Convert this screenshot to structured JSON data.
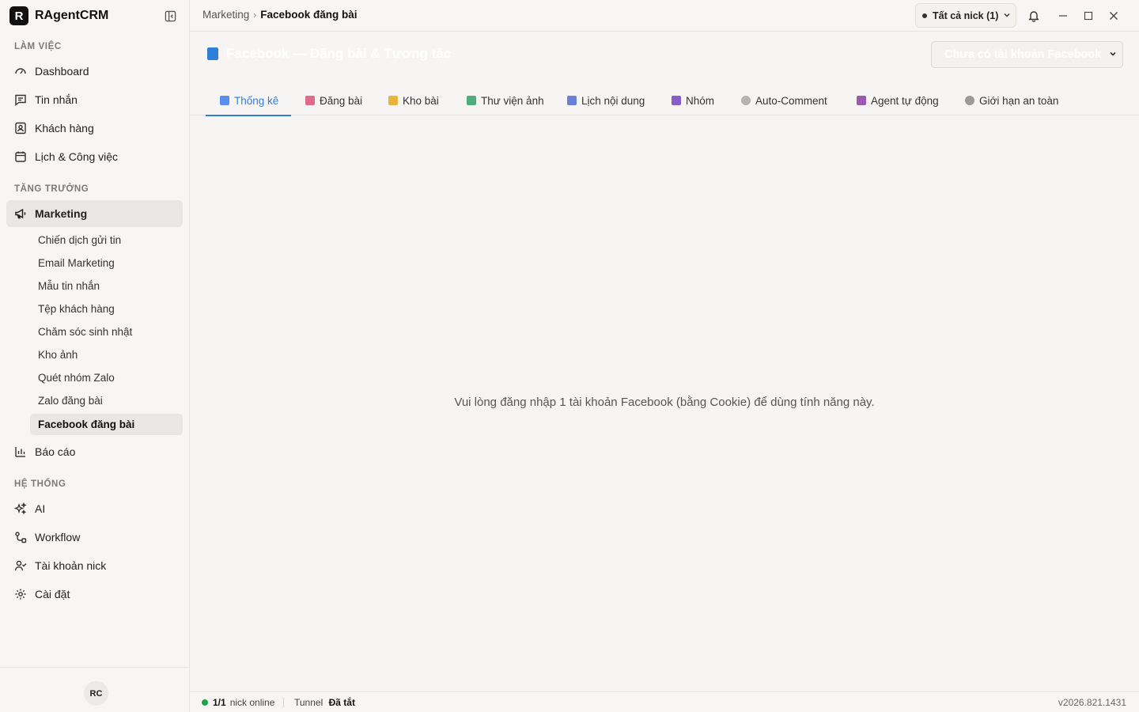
{
  "app": {
    "logo_letter": "R",
    "name": "RAgentCRM"
  },
  "sidebar": {
    "sections": {
      "work": "LÀM VIỆC",
      "growth": "TĂNG TRƯỞNG",
      "system": "HỆ THỐNG"
    },
    "work_items": [
      {
        "label": "Dashboard",
        "icon": "gauge-icon"
      },
      {
        "label": "Tin nhắn",
        "icon": "message-icon"
      },
      {
        "label": "Khách hàng",
        "icon": "contact-icon"
      },
      {
        "label": "Lịch & Công việc",
        "icon": "calendar-icon"
      }
    ],
    "marketing": {
      "label": "Marketing",
      "icon": "megaphone-icon"
    },
    "marketing_sub": [
      "Chiến dịch gửi tin",
      "Email Marketing",
      "Mẫu tin nhắn",
      "Tệp khách hàng",
      "Chăm sóc sinh nhật",
      "Kho ảnh",
      "Quét nhóm Zalo",
      "Zalo đăng bài",
      "Facebook đăng bài"
    ],
    "reports": {
      "label": "Báo cáo",
      "icon": "bar-chart-icon"
    },
    "system_items": [
      {
        "label": "AI",
        "icon": "sparkles-icon"
      },
      {
        "label": "Workflow",
        "icon": "workflow-icon"
      },
      {
        "label": "Tài khoản nick",
        "icon": "user-check-icon"
      },
      {
        "label": "Cài đặt",
        "icon": "gear-icon"
      }
    ],
    "avatar_initials": "RC"
  },
  "topbar": {
    "breadcrumb": [
      "Marketing",
      "Facebook đăng bài"
    ],
    "nick_selector": "Tất cả nick (1)"
  },
  "page": {
    "title": "Facebook — Đăng bài & Tương tác",
    "account_select": "Chưa có tài khoản Facebook"
  },
  "tabs": [
    {
      "label": "Thống kê",
      "active": true,
      "icon_color": "#5b8def"
    },
    {
      "label": "Đăng bài",
      "active": false,
      "icon_color": "#e06a8a"
    },
    {
      "label": "Kho bài",
      "active": false,
      "icon_color": "#e8b43c"
    },
    {
      "label": "Thư viện ảnh",
      "active": false,
      "icon_color": "#4caf7a"
    },
    {
      "label": "Lịch nội dung",
      "active": false,
      "icon_color": "#6a7fd8"
    },
    {
      "label": "Nhóm",
      "active": false,
      "icon_color": "#8a5cc8"
    },
    {
      "label": "Auto-Comment",
      "active": false,
      "icon_color": "#b7b3ae"
    },
    {
      "label": "Agent tự động",
      "active": false,
      "icon_color": "#9a5ab0"
    },
    {
      "label": "Giới hạn an toàn",
      "active": false,
      "icon_color": "#9a9a9a"
    }
  ],
  "content": {
    "message": "Vui lòng đăng nhập 1 tài khoản Facebook (bằng Cookie) để dùng tính năng này."
  },
  "status": {
    "online_count": "1/1",
    "online_label": "nick online",
    "tunnel_label": "Tunnel",
    "tunnel_state": "Đã tắt",
    "version": "v2026.821.1431"
  }
}
